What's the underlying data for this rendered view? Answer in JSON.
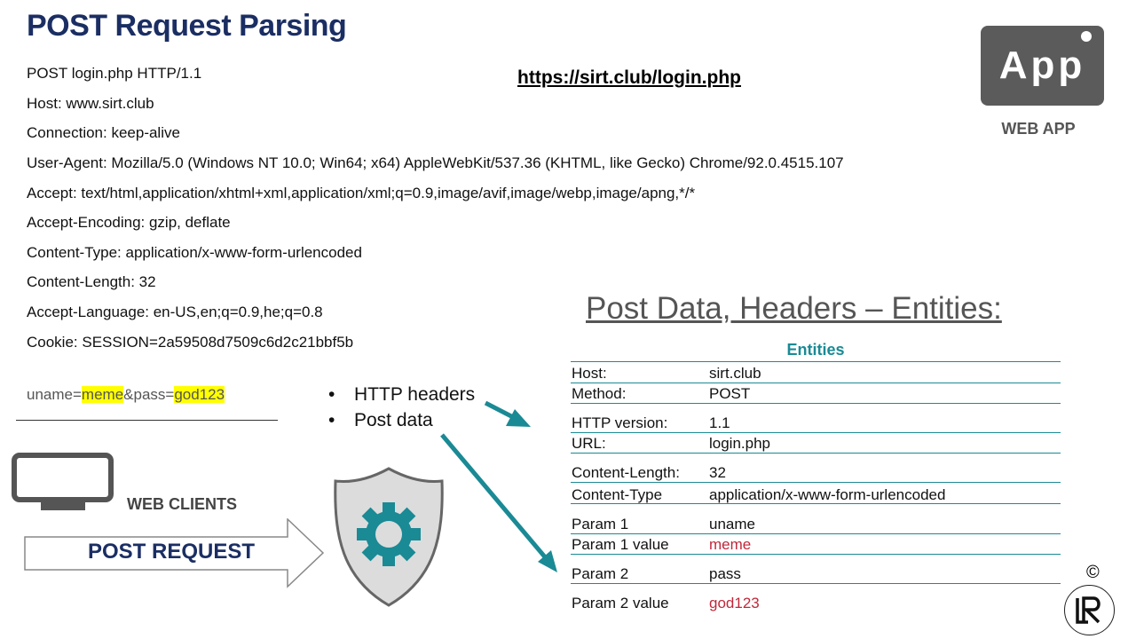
{
  "title": "POST Request Parsing",
  "request_lines": [
    "POST login.php HTTP/1.1",
    "Host: www.sirt.club",
    "Connection: keep-alive",
    "User-Agent: Mozilla/5.0 (Windows NT 10.0; Win64; x64) AppleWebKit/537.36 (KHTML, like Gecko) Chrome/92.0.4515.107",
    "Accept: text/html,application/xhtml+xml,application/xml;q=0.9,image/avif,image/webp,image/apng,*/*",
    "Accept-Encoding: gzip, deflate",
    "Content-Type: application/x-www-form-urlencoded",
    "Content-Length: 32",
    "Accept-Language: en-US,en;q=0.9,he;q=0.8",
    "Cookie: SESSION=2a59508d7509c6d2c21bbf5b"
  ],
  "url": "https://sirt.club/login.php",
  "app_icon_text": "App",
  "web_app_label": "WEB APP",
  "post_body": {
    "uname_key": "uname=",
    "uname_val": "meme",
    "pass_key": "&pass=",
    "pass_val": "god123"
  },
  "bullets": [
    "HTTP headers",
    "Post data"
  ],
  "web_clients_label": "WEB CLIENTS",
  "post_request_label": "POST REQUEST",
  "entities_title": "Post Data, Headers – Entities:",
  "entities_header": "Entities",
  "entities": [
    {
      "key": "Host:",
      "value": "sirt.club"
    },
    {
      "key": "Method:",
      "value": "POST"
    },
    {
      "key": "HTTP version:",
      "value": "1.1"
    },
    {
      "key": "URL:",
      "value": "login.php"
    },
    {
      "key": "Content-Length:",
      "value": "32"
    },
    {
      "key": "Content-Type",
      "value": "application/x-www-form-urlencoded"
    },
    {
      "key": "Param 1",
      "value": "uname"
    },
    {
      "key": "Param 1 value",
      "value": "meme"
    },
    {
      "key": "Param 2",
      "value": "pass"
    },
    {
      "key": "Param 2 value",
      "value": "god123"
    }
  ],
  "copyright_symbol": "©",
  "colors": {
    "title": "#1b2e63",
    "teal": "#1a8a95",
    "highlight": "#ffff00",
    "param_value": "#c0283a",
    "app_box": "#5b5b5b"
  },
  "icons": [
    "monitor-icon",
    "gear-shield-icon",
    "app-icon",
    "lr-logo"
  ]
}
